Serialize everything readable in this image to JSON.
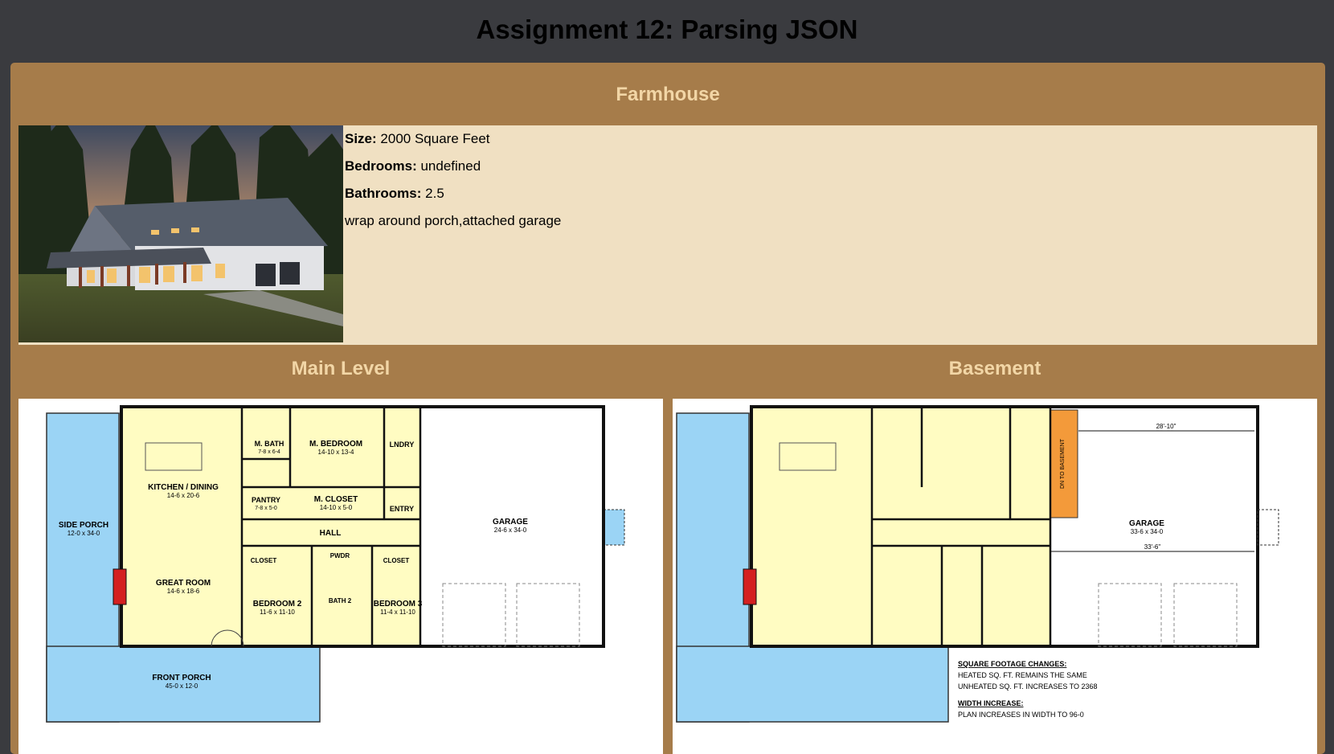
{
  "page": {
    "title": "Assignment 12: Parsing JSON"
  },
  "house": {
    "name": "Farmhouse",
    "size_label": "Size:",
    "size": "2000 Square Feet",
    "bedrooms_label": "Bedrooms:",
    "bedrooms": "undefined",
    "bathrooms_label": "Bathrooms:",
    "bathrooms": "2.5",
    "features": "wrap around porch,attached garage"
  },
  "floors": {
    "main": {
      "title": "Main Level",
      "rooms": {
        "side_porch": "SIDE PORCH",
        "side_porch_dim": "12-0 x 34-0",
        "kitchen": "KITCHEN / DINING",
        "kitchen_dim": "14-6 x 20-6",
        "great_room": "GREAT ROOM",
        "great_room_dim": "14-6 x 18-6",
        "front_porch": "FRONT PORCH",
        "front_porch_dim": "45-0 x 12-0",
        "m_bath": "M. BATH",
        "m_bath_dim": "7-8 x 6-4",
        "m_bedroom": "M. BEDROOM",
        "m_bedroom_dim": "14-10 x 13-4",
        "laundry": "LNDRY",
        "pantry": "PANTRY",
        "pantry_dim": "7-8 x 5-0",
        "m_closet": "M. CLOSET",
        "m_closet_dim": "14-10 x 5-0",
        "entry": "ENTRY",
        "hall": "HALL",
        "closet": "CLOSET",
        "pwdr": "PWDR",
        "bedroom2": "BEDROOM 2",
        "bedroom2_dim": "11-6 x 11-10",
        "bath2": "BATH 2",
        "bedroom3": "BEDROOM 3",
        "bedroom3_dim": "11-4 x 11-10",
        "garage": "GARAGE",
        "garage_dim": "24-6 x 34-0"
      }
    },
    "basement": {
      "title": "Basement",
      "rooms": {
        "garage": "GARAGE",
        "garage_dim": "33-6 x 34-0",
        "stair": "DN TO BASEMENT",
        "width_top": "28'-10\"",
        "width_mid": "33'-6\""
      },
      "notes": {
        "sq_heading": "SQUARE FOOTAGE CHANGES:",
        "sq_line1": "HEATED SQ. FT. REMAINS THE SAME",
        "sq_line2": "UNHEATED SQ. FT. INCREASES TO 2368",
        "width_heading": "WIDTH INCREASE:",
        "width_line": "PLAN INCREASES IN WIDTH TO 96-0"
      }
    }
  },
  "colors": {
    "page_bg": "#3a3b3f",
    "card_bg": "#a67c4a",
    "info_bg": "#f0e0c2",
    "heading_text": "#f2d6a6",
    "porch_fill": "#9bd4f5",
    "interior_fill": "#fffcc2",
    "fireplace": "#d42020",
    "stair_fill": "#f39a3a"
  },
  "icons": {
    "house_photo": "farmhouse-photo",
    "main_plan": "floor-plan-main-level",
    "basement_plan": "floor-plan-basement"
  }
}
